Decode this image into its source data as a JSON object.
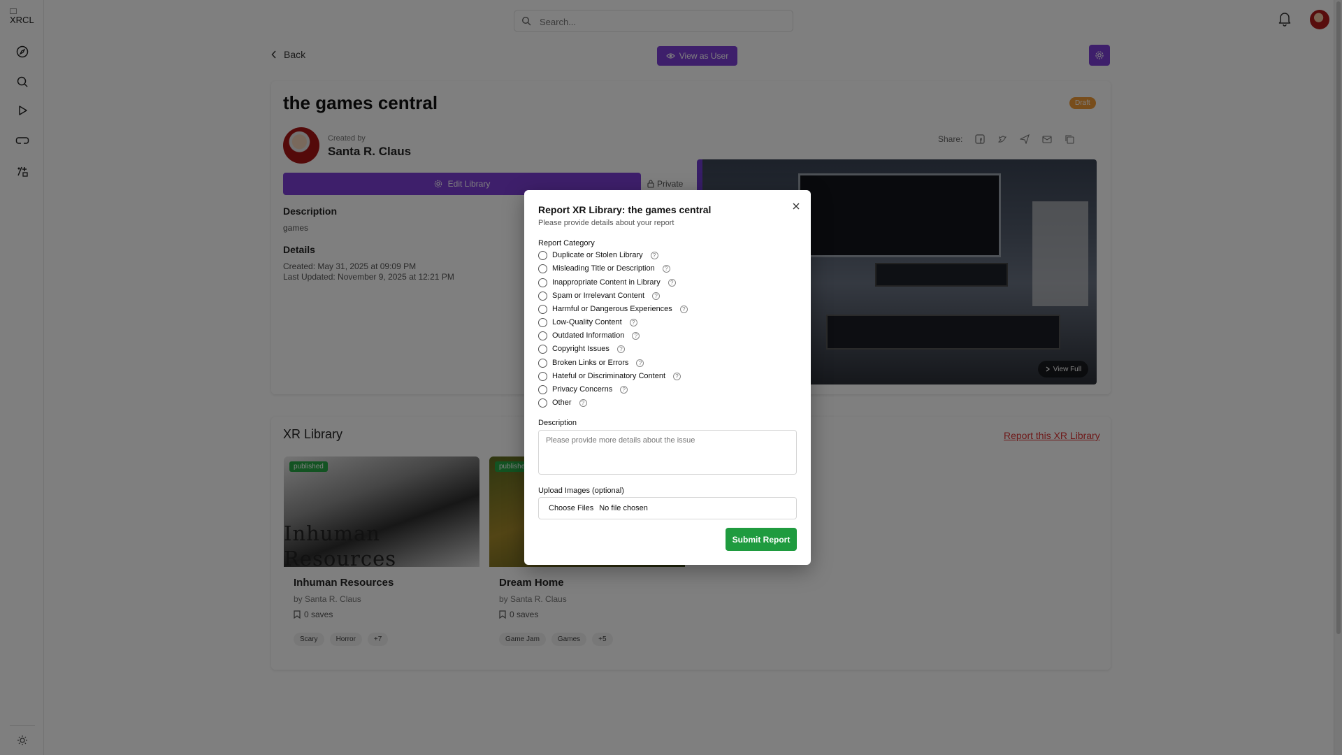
{
  "app": {
    "logo": "XRCL"
  },
  "sidebar": {
    "icons": [
      "compass-icon",
      "search-icon",
      "play-icon",
      "headset-icon",
      "apps-icon"
    ],
    "bottom_icon": "sun-icon"
  },
  "topbar": {
    "search_placeholder": "Search..."
  },
  "page": {
    "back_label": "Back",
    "view_as_user_label": "View as User",
    "title": "the games central",
    "status_badge": "Draft",
    "created_by_label": "Created by",
    "author": "Santa R. Claus",
    "share_label": "Share:",
    "edit_library_label": "Edit Library",
    "private_label": "Private",
    "view_full_label": "View Full",
    "description_heading": "Description",
    "description": "games",
    "details_heading": "Details",
    "created": "Created: May 31, 2025 at 09:09 PM",
    "last_updated": "Last Updated: November 9, 2025 at 12:21 PM"
  },
  "library": {
    "heading": "XR Library",
    "report_link": "Report this XR Library",
    "items": [
      {
        "badge": "published",
        "thumb_text": "Inhuman Resources",
        "name": "Inhuman Resources",
        "by": "by Santa R. Claus",
        "saves": "0 saves",
        "tags": [
          "Scary",
          "Horror",
          "+7"
        ]
      },
      {
        "badge": "published",
        "thumb_text": "",
        "name": "Dream Home",
        "by": "by Santa R. Claus",
        "saves": "0 saves",
        "tags": [
          "Game Jam",
          "Games",
          "+5"
        ]
      }
    ]
  },
  "modal": {
    "title": "Report XR Library: the games central",
    "subtitle": "Please provide details about your report",
    "category_label": "Report Category",
    "options": [
      "Duplicate or Stolen Library",
      "Misleading Title or Description",
      "Inappropriate Content in Library",
      "Spam or Irrelevant Content",
      "Harmful or Dangerous Experiences",
      "Low-Quality Content",
      "Outdated Information",
      "Copyright Issues",
      "Broken Links or Errors",
      "Hateful or Discriminatory Content",
      "Privacy Concerns",
      "Other"
    ],
    "description_label": "Description",
    "description_placeholder": "Please provide more details about the issue",
    "upload_label": "Upload Images (optional)",
    "choose_files_label": "Choose Files",
    "no_file_label": "No file chosen",
    "submit_label": "Submit Report",
    "close_symbol": "×"
  }
}
